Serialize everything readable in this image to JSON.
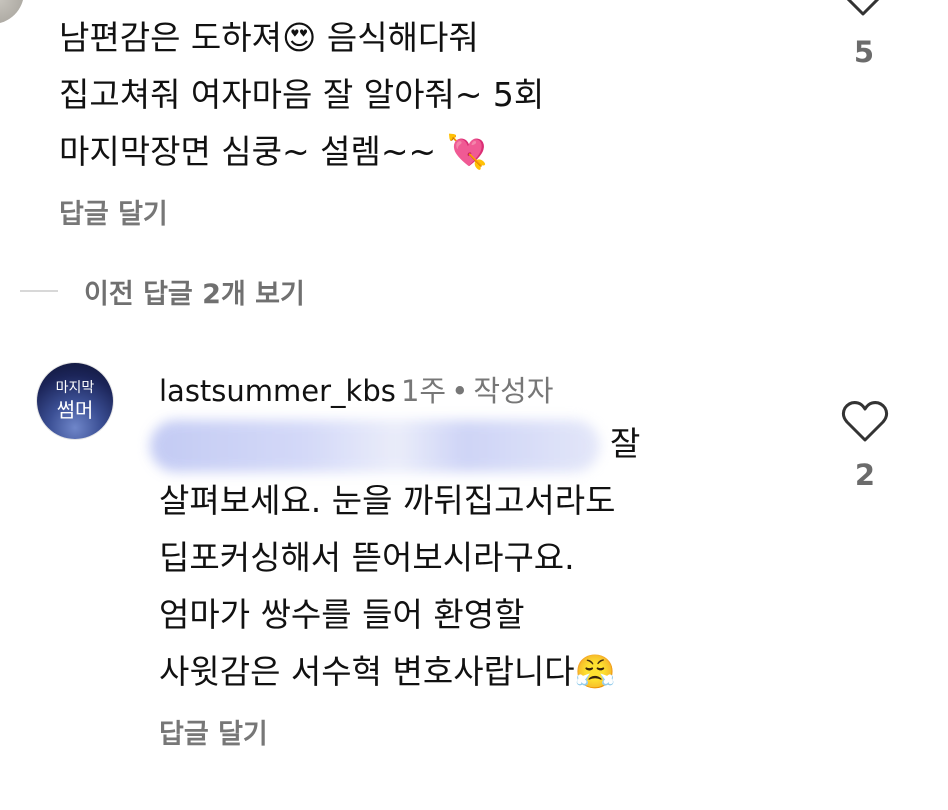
{
  "comment1": {
    "lines": [
      "남편감은 도하져😍  음식해다줘",
      "집고쳐줘 여자마음 잘 알아줘~ 5회",
      "마지막장면 심쿵~ 설렘~~ 💘"
    ],
    "reply_label": "답글 달기",
    "like_count": "5"
  },
  "view_previous_replies": "이전 답글 2개 보기",
  "comment2": {
    "avatar_text_top": "마지막",
    "avatar_text_bottom": "썸머",
    "username": "lastsummer_kbs",
    "time": "1주",
    "separator": "•",
    "author_badge": "작성자",
    "line1_suffix": "잘",
    "lines": [
      "살펴보세요. 눈을 까뒤집고서라도",
      "딥포커싱해서 뜯어보시라구요.",
      "엄마가 쌍수를 들어 환영할",
      "사윗감은 서수혁 변호사랍니다😤"
    ],
    "reply_label": "답글 달기",
    "like_count": "2"
  },
  "icons": {
    "like": "heart-outline-icon"
  }
}
